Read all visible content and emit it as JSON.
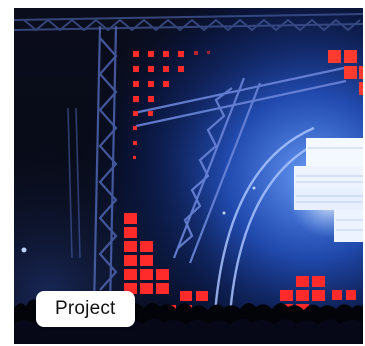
{
  "card": {
    "image_subject": "concert-stage-lights",
    "tag_label": "Project"
  },
  "colors": {
    "stage_background": "#05070f",
    "led_red": "#ff2a2a",
    "spotlight_white": "#eef4ff",
    "haze_blue": "#2f6cff",
    "tag_background": "#ffffff",
    "tag_text": "#111111"
  }
}
